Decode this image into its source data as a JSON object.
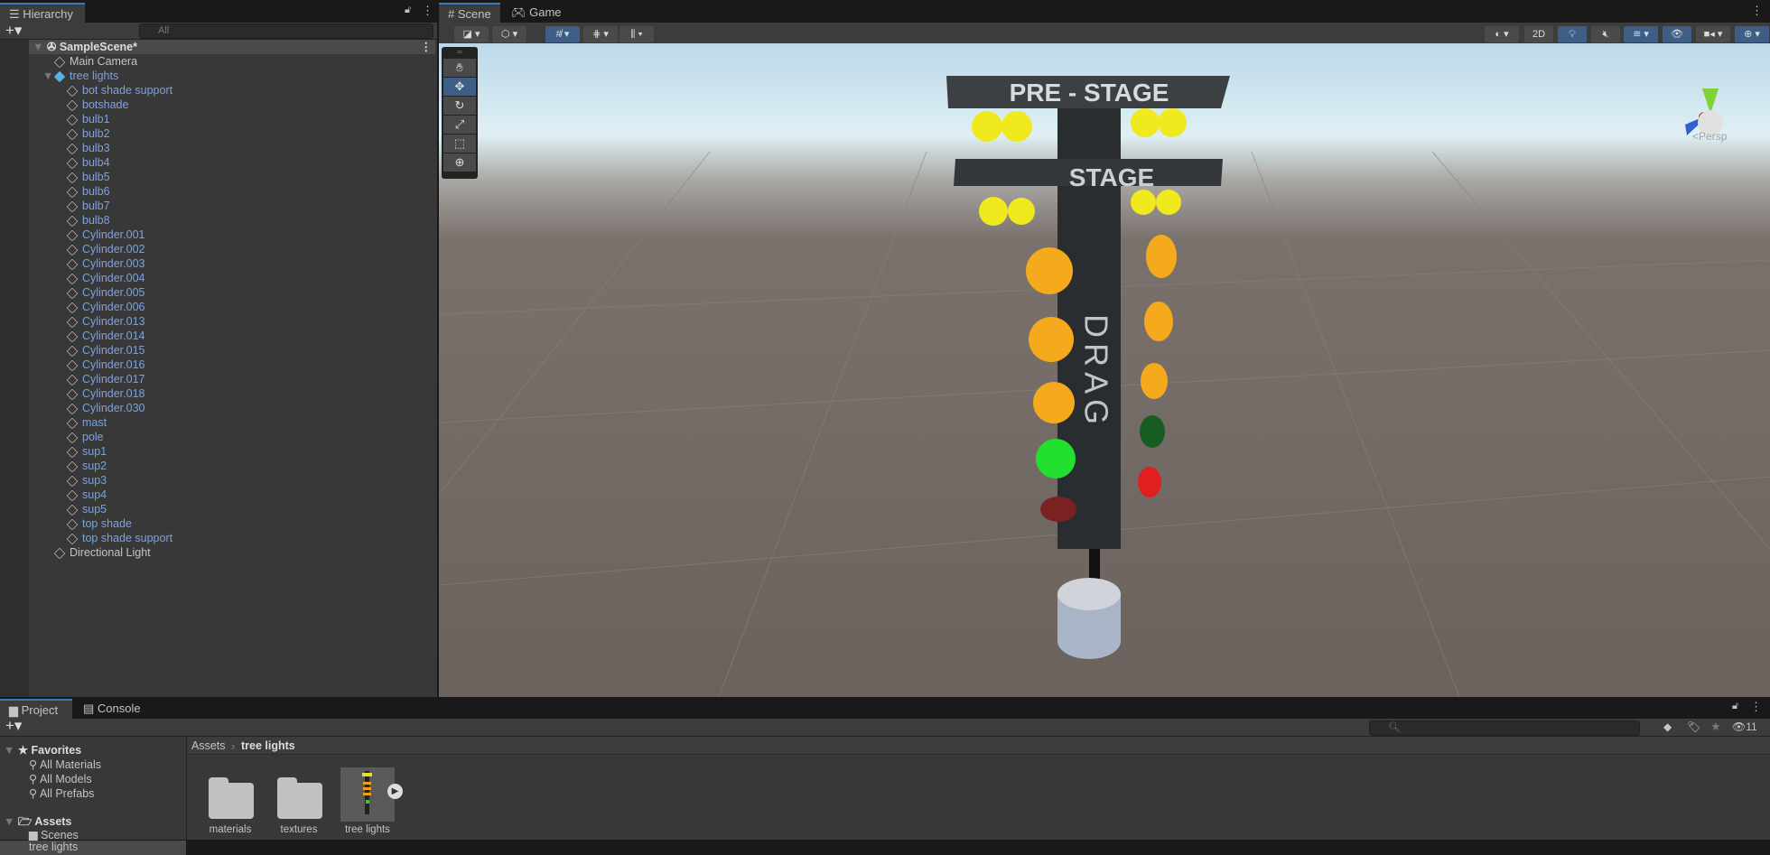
{
  "hierarchy": {
    "tab": "Hierarchy",
    "search_placeholder": "All",
    "scene": "SampleScene*",
    "items": [
      {
        "label": "Main Camera",
        "depth": 1,
        "prefab": false
      },
      {
        "label": "tree lights",
        "depth": 1,
        "prefab": true,
        "expanded": true
      },
      {
        "label": "bot shade support",
        "depth": 2,
        "prefab": true
      },
      {
        "label": "botshade",
        "depth": 2,
        "prefab": true
      },
      {
        "label": "bulb1",
        "depth": 2,
        "prefab": true
      },
      {
        "label": "bulb2",
        "depth": 2,
        "prefab": true
      },
      {
        "label": "bulb3",
        "depth": 2,
        "prefab": true
      },
      {
        "label": "bulb4",
        "depth": 2,
        "prefab": true
      },
      {
        "label": "bulb5",
        "depth": 2,
        "prefab": true
      },
      {
        "label": "bulb6",
        "depth": 2,
        "prefab": true
      },
      {
        "label": "bulb7",
        "depth": 2,
        "prefab": true
      },
      {
        "label": "bulb8",
        "depth": 2,
        "prefab": true
      },
      {
        "label": "Cylinder.001",
        "depth": 2,
        "prefab": true
      },
      {
        "label": "Cylinder.002",
        "depth": 2,
        "prefab": true
      },
      {
        "label": "Cylinder.003",
        "depth": 2,
        "prefab": true
      },
      {
        "label": "Cylinder.004",
        "depth": 2,
        "prefab": true
      },
      {
        "label": "Cylinder.005",
        "depth": 2,
        "prefab": true
      },
      {
        "label": "Cylinder.006",
        "depth": 2,
        "prefab": true
      },
      {
        "label": "Cylinder.013",
        "depth": 2,
        "prefab": true
      },
      {
        "label": "Cylinder.014",
        "depth": 2,
        "prefab": true
      },
      {
        "label": "Cylinder.015",
        "depth": 2,
        "prefab": true
      },
      {
        "label": "Cylinder.016",
        "depth": 2,
        "prefab": true
      },
      {
        "label": "Cylinder.017",
        "depth": 2,
        "prefab": true
      },
      {
        "label": "Cylinder.018",
        "depth": 2,
        "prefab": true
      },
      {
        "label": "Cylinder.030",
        "depth": 2,
        "prefab": true
      },
      {
        "label": "mast",
        "depth": 2,
        "prefab": true
      },
      {
        "label": "pole",
        "depth": 2,
        "prefab": true
      },
      {
        "label": "sup1",
        "depth": 2,
        "prefab": true
      },
      {
        "label": "sup2",
        "depth": 2,
        "prefab": true
      },
      {
        "label": "sup3",
        "depth": 2,
        "prefab": true
      },
      {
        "label": "sup4",
        "depth": 2,
        "prefab": true
      },
      {
        "label": "sup5",
        "depth": 2,
        "prefab": true
      },
      {
        "label": "top shade",
        "depth": 2,
        "prefab": true
      },
      {
        "label": "top shade support",
        "depth": 2,
        "prefab": true
      },
      {
        "label": "Directional Light",
        "depth": 1,
        "prefab": false
      }
    ]
  },
  "scene_view": {
    "tabs": [
      "Scene",
      "Game"
    ],
    "btn_2d": "2D",
    "persp_label": "Persp",
    "gizmo_axes": [
      "y",
      "x",
      "z"
    ],
    "sign_top": "PRE - STAGE",
    "sign_mid": "STAGE",
    "mast_text": "DRAG"
  },
  "project": {
    "tabs": [
      "Project",
      "Console"
    ],
    "favorites_label": "Favorites",
    "favorites": [
      "All Materials",
      "All Models",
      "All Prefabs"
    ],
    "assets_label": "Assets",
    "assets_children": [
      "Scenes",
      "tree lights"
    ],
    "breadcrumb": [
      "Assets",
      "tree lights"
    ],
    "items": [
      {
        "label": "materials",
        "type": "folder"
      },
      {
        "label": "textures",
        "type": "folder"
      },
      {
        "label": "tree lights",
        "type": "prefab"
      }
    ],
    "hidden_count": "11"
  }
}
